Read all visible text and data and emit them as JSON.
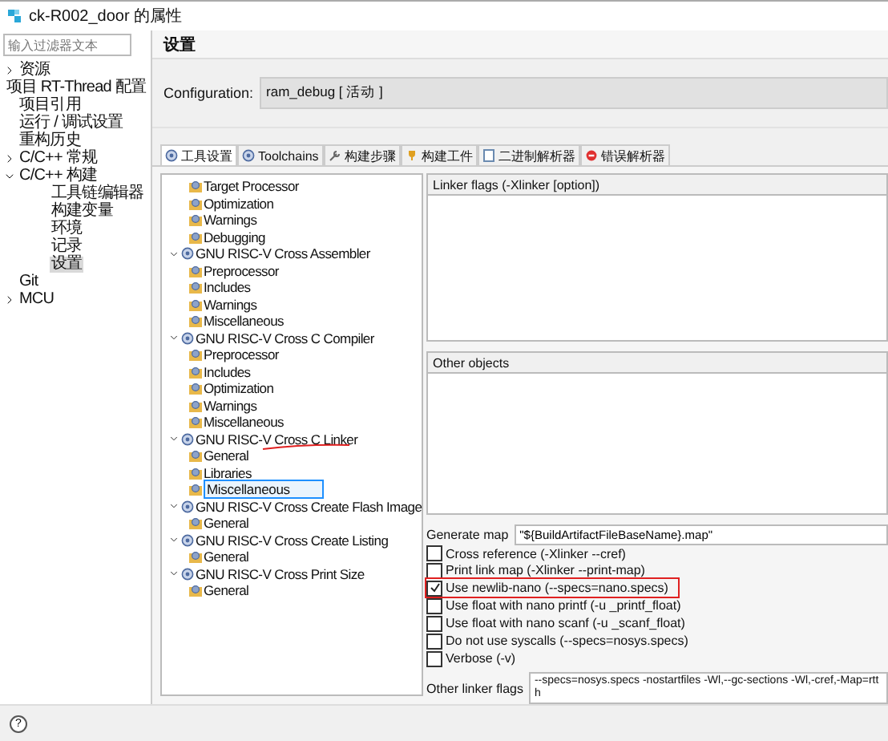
{
  "window": {
    "title": "ck-R002_door 的属性"
  },
  "filter": {
    "placeholder": "输入过滤器文本"
  },
  "sidebar": {
    "items": [
      {
        "label": "资源",
        "expanded": false,
        "selected": false
      },
      {
        "label": "项目 RT-Thread 配置",
        "selected": false
      },
      {
        "label": "项目引用",
        "selected": false
      },
      {
        "label": "运行 / 调试设置",
        "selected": false
      },
      {
        "label": "重构历史",
        "selected": false
      },
      {
        "label": "C/C++ 常规",
        "expanded": false,
        "selected": false
      },
      {
        "label": "C/C++ 构建",
        "expanded": true,
        "selected": false,
        "children": [
          {
            "label": "工具链编辑器",
            "selected": false
          },
          {
            "label": "构建变量",
            "selected": false
          },
          {
            "label": "环境",
            "selected": false
          },
          {
            "label": "记录",
            "selected": false
          },
          {
            "label": "设置",
            "selected": true
          }
        ]
      },
      {
        "label": "Git",
        "selected": false
      },
      {
        "label": "MCU",
        "expanded": false,
        "selected": false
      }
    ]
  },
  "page": {
    "title": "设置"
  },
  "configuration": {
    "label": "Configuration:",
    "value": "ram_debug  [ 活动 ]"
  },
  "tabs": [
    {
      "label": "工具设置",
      "kind": "tool",
      "selected": true
    },
    {
      "label": "Toolchains",
      "kind": "tool",
      "selected": false
    },
    {
      "label": "构建步骤",
      "kind": "wrench",
      "selected": false
    },
    {
      "label": "构建工件",
      "kind": "artifact",
      "selected": false
    },
    {
      "label": "二进制解析器",
      "kind": "file",
      "selected": false
    },
    {
      "label": "错误解析器",
      "kind": "error",
      "selected": false
    }
  ],
  "tool_tree": [
    {
      "label": "Target Processor",
      "kind": "option"
    },
    {
      "label": "Optimization",
      "kind": "option"
    },
    {
      "label": "Warnings",
      "kind": "option"
    },
    {
      "label": "Debugging",
      "kind": "option"
    },
    {
      "label": "GNU RISC-V Cross Assembler",
      "kind": "tool",
      "expanded": true,
      "children": [
        {
          "label": "Preprocessor",
          "kind": "option"
        },
        {
          "label": "Includes",
          "kind": "option"
        },
        {
          "label": "Warnings",
          "kind": "option"
        },
        {
          "label": "Miscellaneous",
          "kind": "option"
        }
      ]
    },
    {
      "label": "GNU RISC-V Cross C Compiler",
      "kind": "tool",
      "expanded": true,
      "children": [
        {
          "label": "Preprocessor",
          "kind": "option"
        },
        {
          "label": "Includes",
          "kind": "option"
        },
        {
          "label": "Optimization",
          "kind": "option"
        },
        {
          "label": "Warnings",
          "kind": "option"
        },
        {
          "label": "Miscellaneous",
          "kind": "option"
        }
      ]
    },
    {
      "label": "GNU RISC-V Cross C Linker",
      "kind": "tool",
      "expanded": true,
      "underlined": true,
      "children": [
        {
          "label": "General",
          "kind": "option"
        },
        {
          "label": "Libraries",
          "kind": "option"
        },
        {
          "label": "Miscellaneous",
          "kind": "option",
          "highlighted": true
        }
      ]
    },
    {
      "label": "GNU RISC-V Cross Create Flash Image",
      "kind": "tool",
      "expanded": true,
      "children": [
        {
          "label": "General",
          "kind": "option"
        }
      ]
    },
    {
      "label": "GNU RISC-V Cross Create Listing",
      "kind": "tool",
      "expanded": true,
      "children": [
        {
          "label": "General",
          "kind": "option"
        }
      ]
    },
    {
      "label": "GNU RISC-V Cross Print Size",
      "kind": "tool",
      "expanded": true,
      "children": [
        {
          "label": "General",
          "kind": "option"
        }
      ]
    }
  ],
  "linker_flags": {
    "title": "Linker flags (-Xlinker [option])"
  },
  "other_objects": {
    "title": "Other objects"
  },
  "generate_map": {
    "label": "Generate map",
    "value": "\"${BuildArtifactFileBaseName}.map\""
  },
  "options": [
    {
      "label": "Cross reference (-Xlinker --cref)",
      "checked": false,
      "highlighted": false
    },
    {
      "label": "Print link map (-Xlinker --print-map)",
      "checked": false,
      "highlighted": false
    },
    {
      "label": "Use newlib-nano (--specs=nano.specs)",
      "checked": true,
      "highlighted": true
    },
    {
      "label": "Use float with nano printf (-u _printf_float)",
      "checked": false,
      "highlighted": false
    },
    {
      "label": "Use float with nano scanf (-u _scanf_float)",
      "checked": false,
      "highlighted": false
    },
    {
      "label": "Do not use syscalls (--specs=nosys.specs)",
      "checked": false,
      "highlighted": false
    },
    {
      "label": "Verbose (-v)",
      "checked": false,
      "highlighted": false
    }
  ],
  "other_linker_flags": {
    "label": "Other linker flags",
    "value": "--specs=nosys.specs -nostartfiles -Wl,--gc-sections -Wl,-cref,-Map=rtth"
  },
  "help": {
    "label": "?"
  }
}
